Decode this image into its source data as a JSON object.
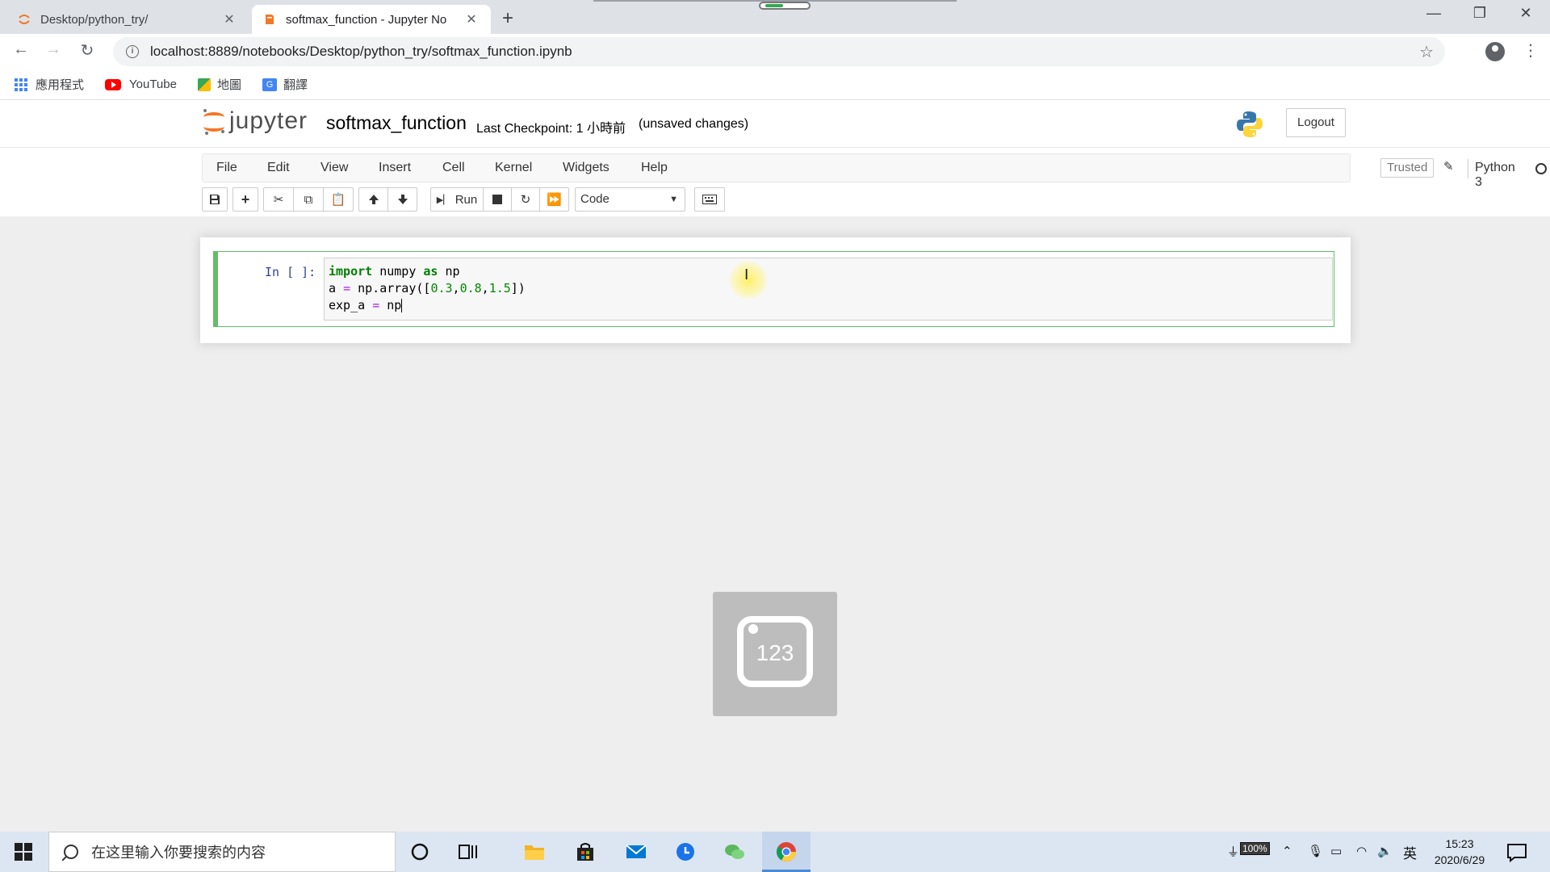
{
  "browser": {
    "tabs": [
      {
        "title": "Desktop/python_try/",
        "active": false
      },
      {
        "title": "softmax_function - Jupyter No",
        "active": true
      }
    ],
    "new_tab": "+",
    "url": "localhost:8889/notebooks/Desktop/python_try/softmax_function.ipynb",
    "bookmarks": [
      "應用程式",
      "YouTube",
      "地圖",
      "翻譯"
    ]
  },
  "jupyter": {
    "logo_text": "jupyter",
    "notebook_title": "softmax_function",
    "checkpoint": "Last Checkpoint: 1 小時前",
    "unsaved": "(unsaved changes)",
    "logout": "Logout",
    "menu": [
      "File",
      "Edit",
      "View",
      "Insert",
      "Cell",
      "Kernel",
      "Widgets",
      "Help"
    ],
    "trusted": "Trusted",
    "kernel_name": "Python 3",
    "toolbar": {
      "run_label": "Run",
      "cell_type": "Code"
    },
    "cell": {
      "prompt": "In [ ]:",
      "code_lines": [
        "import numpy as np",
        "a = np.array([0.3,0.8,1.5])",
        "exp_a = np"
      ]
    }
  },
  "overlay": {
    "label": "123"
  },
  "taskbar": {
    "search_placeholder": "在这里输入你要搜索的内容",
    "battery": "100%",
    "ime": "英",
    "time": "15:23",
    "date": "2020/6/29"
  },
  "colors": {
    "jupyter_orange": "#f37726",
    "cell_selected_border": "#66bb6a",
    "taskbar_bg": "#dce6f2"
  }
}
